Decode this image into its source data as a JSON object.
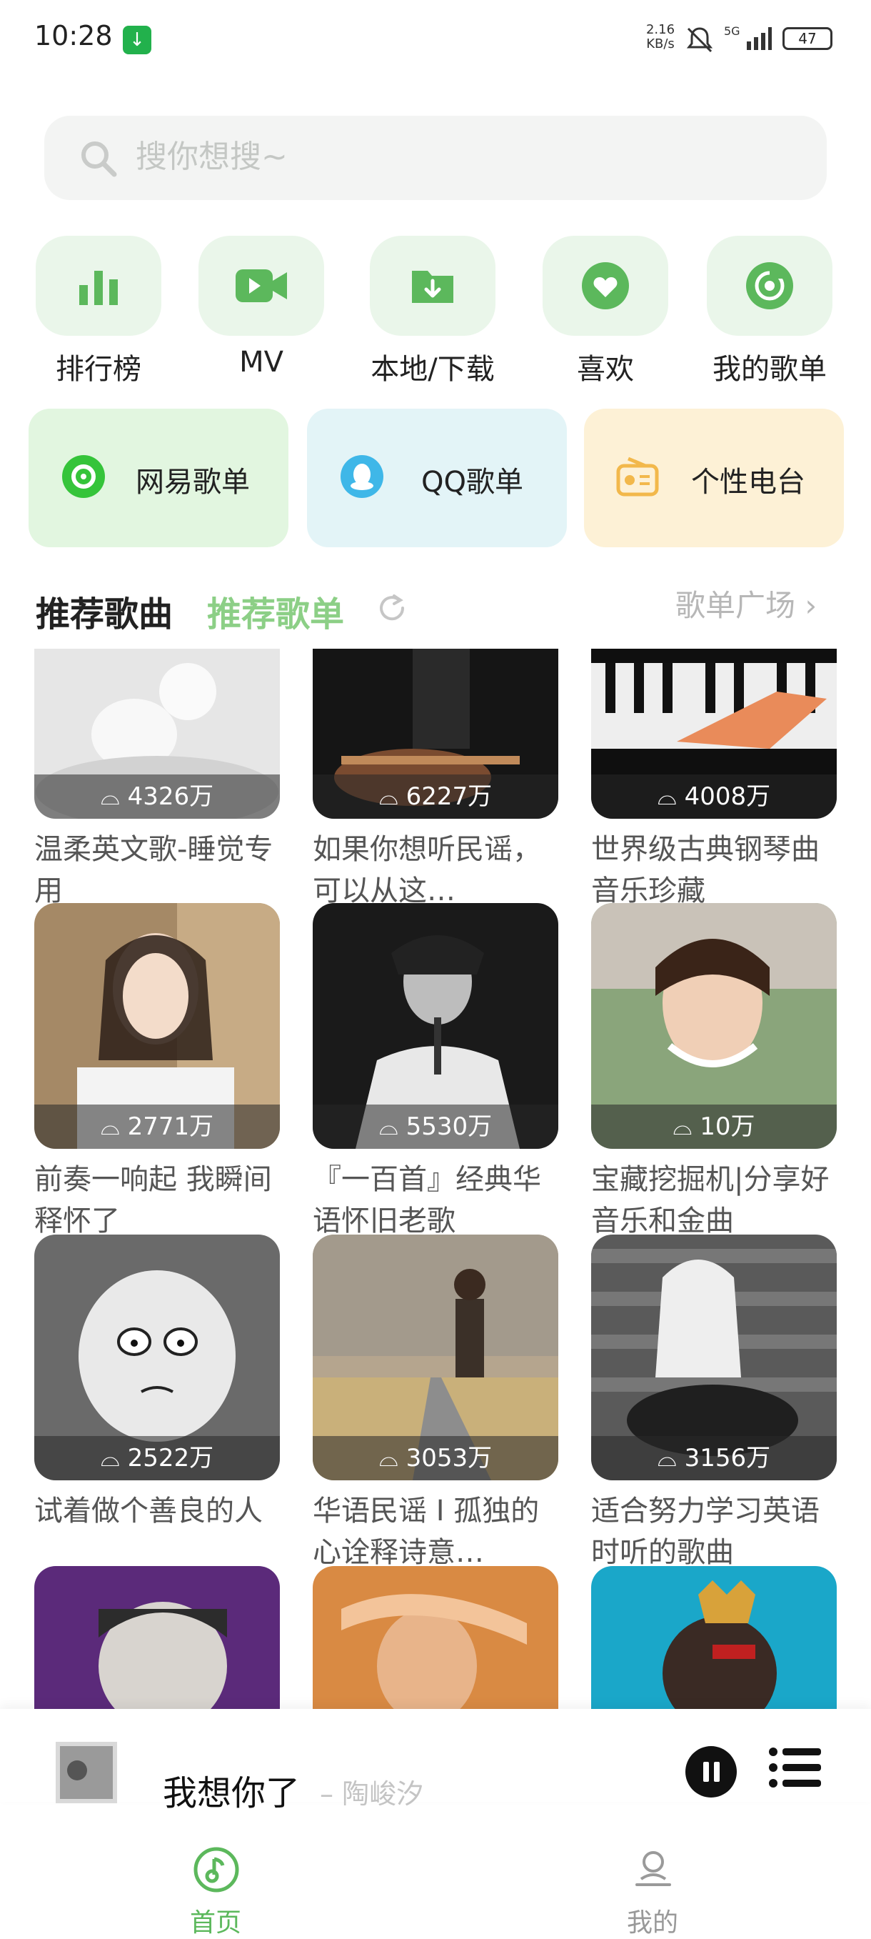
{
  "status": {
    "time": "10:28",
    "speed": "2.16\nKB/s",
    "network": "5G",
    "battery": "47"
  },
  "search": {
    "placeholder": "搜你想搜~"
  },
  "quick_actions": [
    {
      "label": "排行榜",
      "icon": "bar-chart-icon"
    },
    {
      "label": "MV",
      "icon": "video-icon"
    },
    {
      "label": "本地/下载",
      "icon": "download-folder-icon"
    },
    {
      "label": "喜欢",
      "icon": "heart-icon"
    },
    {
      "label": "我的歌单",
      "icon": "disc-icon"
    }
  ],
  "cards": [
    {
      "label": "网易歌单",
      "icon": "netease-icon"
    },
    {
      "label": "QQ歌单",
      "icon": "qq-icon"
    },
    {
      "label": "个性电台",
      "icon": "radio-icon"
    }
  ],
  "section": {
    "tab_songs": "推荐歌曲",
    "tab_playlists": "推荐歌单",
    "square_link": "歌单广场 ›"
  },
  "playlists": [
    {
      "count": "4326万",
      "title": "温柔英文歌-睡觉专用"
    },
    {
      "count": "6227万",
      "title": "如果你想听民谣，可以从这…"
    },
    {
      "count": "4008万",
      "title": "世界级古典钢琴曲音乐珍藏"
    },
    {
      "count": "2771万",
      "title": "前奏一响起 我瞬间释怀了"
    },
    {
      "count": "5530万",
      "title": "『一百首』经典华语怀旧老歌"
    },
    {
      "count": "10万",
      "title": "宝藏挖掘机|分享好音乐和金曲"
    },
    {
      "count": "2522万",
      "title": "试着做个善良的人"
    },
    {
      "count": "3053万",
      "title": "华语民谣 I 孤独的心诠释诗意…"
    },
    {
      "count": "3156万",
      "title": "适合努力学习英语时听的歌曲"
    },
    {
      "count": "",
      "title": ""
    },
    {
      "count": "",
      "title": ""
    },
    {
      "count": "",
      "title": ""
    }
  ],
  "player": {
    "title": "我想你了",
    "artist": "– 陶峻汐"
  },
  "nav": {
    "home": "首页",
    "mine": "我的"
  },
  "colors": {
    "accent": "#5cb85c",
    "icon_bg": "#eaf6ea",
    "card_green": "#e2f6e0",
    "card_blue": "#e3f4f7",
    "card_yellow": "#fdf1d6"
  }
}
